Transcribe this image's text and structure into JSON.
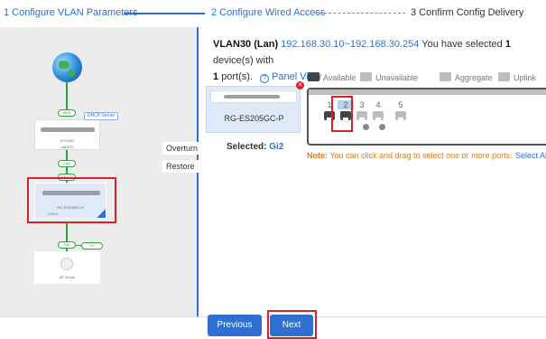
{
  "steps": {
    "step1": "1 Configure VLAN Parameters",
    "step2": "2 Configure Wired Access",
    "step3": "3 Confirm Config Delivery"
  },
  "topology": {
    "pill_top": "WAN",
    "dhcp_label": "DHCP Server",
    "gateway_name": "EG105G",
    "gateway_sub": "0AE070",
    "pill_mid1": "LAN",
    "pill_mid2": "GE 0/1",
    "switch_name": "RG-ES205GC-P",
    "switch_sub": "G1EG",
    "pill_bottom": "Port",
    "count_label": "2/2",
    "ap_label": "AP Group"
  },
  "side_buttons": {
    "overturn": "Overturn",
    "restore": "Restore"
  },
  "header": {
    "vlan": "VLAN30 (Lan)",
    "ip_range": "192.168.30.10~192.168.30.254",
    "selected_prefix": "You have selected",
    "selected_count": "1",
    "selected_suffix": "device(s) with",
    "port_count": "1",
    "port_suffix": "port(s).",
    "panel_view": "Panel View"
  },
  "legend": {
    "available": "Available",
    "unavailable": "Unavailable",
    "aggregate": "Aggregate",
    "uplink": "Uplink"
  },
  "device_card": {
    "name": "RG-ES205GC-P"
  },
  "selected": {
    "label": "Selected:",
    "value": "Gi2"
  },
  "ports": [
    {
      "num": "1",
      "state": "available"
    },
    {
      "num": "2",
      "state": "selected"
    },
    {
      "num": "3",
      "state": "unavailable"
    },
    {
      "num": "4",
      "state": "unavailable"
    },
    {
      "num": "5",
      "state": "unavailable"
    }
  ],
  "note": {
    "prefix": "Note:",
    "text": "You can click and drag to select one or more ports.",
    "select_all": "Select All"
  },
  "footer": {
    "previous": "Previous",
    "next": "Next"
  },
  "colors": {
    "accent": "#2f6fd1",
    "highlight": "#d8212a",
    "link_green": "#2aa641",
    "note": "#e07c1b"
  }
}
